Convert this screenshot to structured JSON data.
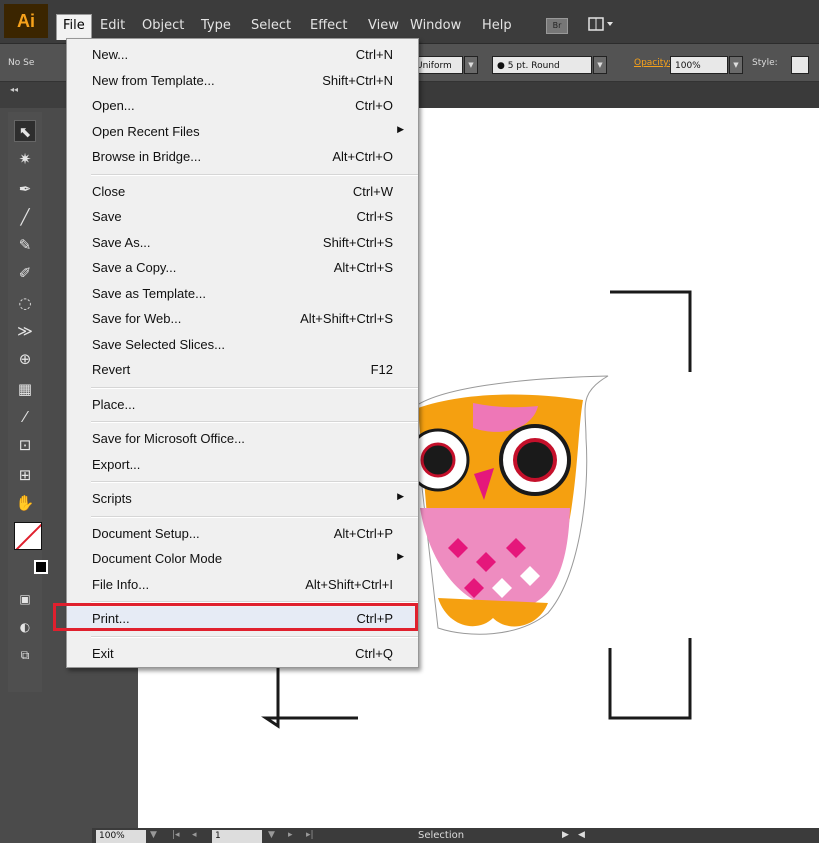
{
  "app": {
    "logo": "Ai"
  },
  "menubar": {
    "items": [
      "File",
      "Edit",
      "Object",
      "Type",
      "Select",
      "Effect",
      "View",
      "Window",
      "Help"
    ],
    "bridge_label": "Br",
    "arrange_icon": "layout-grid-icon"
  },
  "controlbar": {
    "selection_label": "No Se",
    "stroke_profile": "Uniform",
    "brush": "5 pt. Round",
    "opacity_label": "Opacity:",
    "opacity_value": "100%",
    "style_label": "Style:"
  },
  "tabstrip": {
    "collapse": "◂◂"
  },
  "file_menu": {
    "groups": [
      [
        {
          "label": "New...",
          "shortcut": "Ctrl+N"
        },
        {
          "label": "New from Template...",
          "shortcut": "Shift+Ctrl+N"
        },
        {
          "label": "Open...",
          "shortcut": "Ctrl+O"
        },
        {
          "label": "Open Recent Files",
          "shortcut": "",
          "submenu": true
        },
        {
          "label": "Browse in Bridge...",
          "shortcut": "Alt+Ctrl+O"
        }
      ],
      [
        {
          "label": "Close",
          "shortcut": "Ctrl+W"
        },
        {
          "label": "Save",
          "shortcut": "Ctrl+S"
        },
        {
          "label": "Save As...",
          "shortcut": "Shift+Ctrl+S"
        },
        {
          "label": "Save a Copy...",
          "shortcut": "Alt+Ctrl+S"
        },
        {
          "label": "Save as Template...",
          "shortcut": ""
        },
        {
          "label": "Save for Web...",
          "shortcut": "Alt+Shift+Ctrl+S"
        },
        {
          "label": "Save Selected Slices...",
          "shortcut": ""
        },
        {
          "label": "Revert",
          "shortcut": "F12"
        }
      ],
      [
        {
          "label": "Place...",
          "shortcut": ""
        }
      ],
      [
        {
          "label": "Save for Microsoft Office...",
          "shortcut": ""
        },
        {
          "label": "Export...",
          "shortcut": ""
        }
      ],
      [
        {
          "label": "Scripts",
          "shortcut": "",
          "submenu": true
        }
      ],
      [
        {
          "label": "Document Setup...",
          "shortcut": "Alt+Ctrl+P"
        },
        {
          "label": "Document Color Mode",
          "shortcut": "",
          "submenu": true
        },
        {
          "label": "File Info...",
          "shortcut": "Alt+Shift+Ctrl+I"
        }
      ],
      [
        {
          "label": "Print...",
          "shortcut": "Ctrl+P",
          "highlighted": true
        }
      ],
      [
        {
          "label": "Exit",
          "shortcut": "Ctrl+Q"
        }
      ]
    ]
  },
  "statusbar": {
    "zoom": "100%",
    "page": "1",
    "status": "Selection"
  },
  "colors": {
    "accent": "#f7a21b",
    "highlight_box": "#e0202e"
  }
}
